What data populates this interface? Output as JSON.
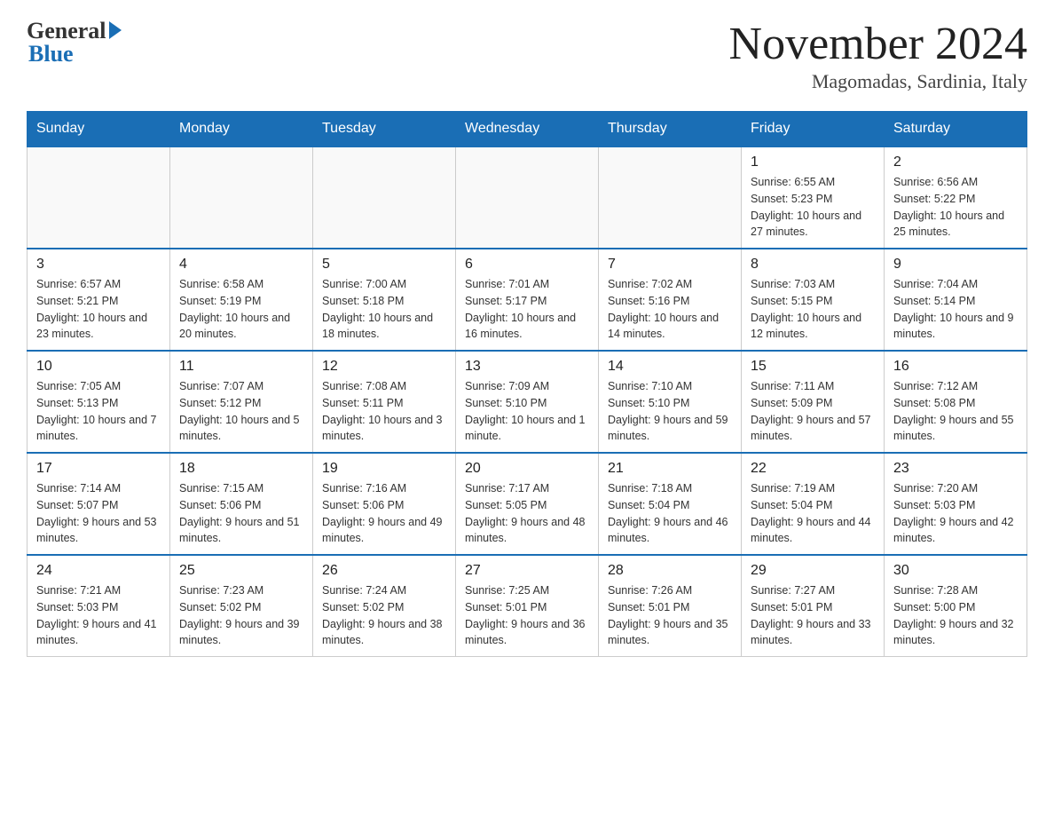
{
  "logo": {
    "general": "General",
    "blue": "Blue"
  },
  "title": "November 2024",
  "subtitle": "Magomadas, Sardinia, Italy",
  "weekdays": [
    "Sunday",
    "Monday",
    "Tuesday",
    "Wednesday",
    "Thursday",
    "Friday",
    "Saturday"
  ],
  "weeks": [
    [
      {
        "day": "",
        "info": ""
      },
      {
        "day": "",
        "info": ""
      },
      {
        "day": "",
        "info": ""
      },
      {
        "day": "",
        "info": ""
      },
      {
        "day": "",
        "info": ""
      },
      {
        "day": "1",
        "info": "Sunrise: 6:55 AM\nSunset: 5:23 PM\nDaylight: 10 hours and 27 minutes."
      },
      {
        "day": "2",
        "info": "Sunrise: 6:56 AM\nSunset: 5:22 PM\nDaylight: 10 hours and 25 minutes."
      }
    ],
    [
      {
        "day": "3",
        "info": "Sunrise: 6:57 AM\nSunset: 5:21 PM\nDaylight: 10 hours and 23 minutes."
      },
      {
        "day": "4",
        "info": "Sunrise: 6:58 AM\nSunset: 5:19 PM\nDaylight: 10 hours and 20 minutes."
      },
      {
        "day": "5",
        "info": "Sunrise: 7:00 AM\nSunset: 5:18 PM\nDaylight: 10 hours and 18 minutes."
      },
      {
        "day": "6",
        "info": "Sunrise: 7:01 AM\nSunset: 5:17 PM\nDaylight: 10 hours and 16 minutes."
      },
      {
        "day": "7",
        "info": "Sunrise: 7:02 AM\nSunset: 5:16 PM\nDaylight: 10 hours and 14 minutes."
      },
      {
        "day": "8",
        "info": "Sunrise: 7:03 AM\nSunset: 5:15 PM\nDaylight: 10 hours and 12 minutes."
      },
      {
        "day": "9",
        "info": "Sunrise: 7:04 AM\nSunset: 5:14 PM\nDaylight: 10 hours and 9 minutes."
      }
    ],
    [
      {
        "day": "10",
        "info": "Sunrise: 7:05 AM\nSunset: 5:13 PM\nDaylight: 10 hours and 7 minutes."
      },
      {
        "day": "11",
        "info": "Sunrise: 7:07 AM\nSunset: 5:12 PM\nDaylight: 10 hours and 5 minutes."
      },
      {
        "day": "12",
        "info": "Sunrise: 7:08 AM\nSunset: 5:11 PM\nDaylight: 10 hours and 3 minutes."
      },
      {
        "day": "13",
        "info": "Sunrise: 7:09 AM\nSunset: 5:10 PM\nDaylight: 10 hours and 1 minute."
      },
      {
        "day": "14",
        "info": "Sunrise: 7:10 AM\nSunset: 5:10 PM\nDaylight: 9 hours and 59 minutes."
      },
      {
        "day": "15",
        "info": "Sunrise: 7:11 AM\nSunset: 5:09 PM\nDaylight: 9 hours and 57 minutes."
      },
      {
        "day": "16",
        "info": "Sunrise: 7:12 AM\nSunset: 5:08 PM\nDaylight: 9 hours and 55 minutes."
      }
    ],
    [
      {
        "day": "17",
        "info": "Sunrise: 7:14 AM\nSunset: 5:07 PM\nDaylight: 9 hours and 53 minutes."
      },
      {
        "day": "18",
        "info": "Sunrise: 7:15 AM\nSunset: 5:06 PM\nDaylight: 9 hours and 51 minutes."
      },
      {
        "day": "19",
        "info": "Sunrise: 7:16 AM\nSunset: 5:06 PM\nDaylight: 9 hours and 49 minutes."
      },
      {
        "day": "20",
        "info": "Sunrise: 7:17 AM\nSunset: 5:05 PM\nDaylight: 9 hours and 48 minutes."
      },
      {
        "day": "21",
        "info": "Sunrise: 7:18 AM\nSunset: 5:04 PM\nDaylight: 9 hours and 46 minutes."
      },
      {
        "day": "22",
        "info": "Sunrise: 7:19 AM\nSunset: 5:04 PM\nDaylight: 9 hours and 44 minutes."
      },
      {
        "day": "23",
        "info": "Sunrise: 7:20 AM\nSunset: 5:03 PM\nDaylight: 9 hours and 42 minutes."
      }
    ],
    [
      {
        "day": "24",
        "info": "Sunrise: 7:21 AM\nSunset: 5:03 PM\nDaylight: 9 hours and 41 minutes."
      },
      {
        "day": "25",
        "info": "Sunrise: 7:23 AM\nSunset: 5:02 PM\nDaylight: 9 hours and 39 minutes."
      },
      {
        "day": "26",
        "info": "Sunrise: 7:24 AM\nSunset: 5:02 PM\nDaylight: 9 hours and 38 minutes."
      },
      {
        "day": "27",
        "info": "Sunrise: 7:25 AM\nSunset: 5:01 PM\nDaylight: 9 hours and 36 minutes."
      },
      {
        "day": "28",
        "info": "Sunrise: 7:26 AM\nSunset: 5:01 PM\nDaylight: 9 hours and 35 minutes."
      },
      {
        "day": "29",
        "info": "Sunrise: 7:27 AM\nSunset: 5:01 PM\nDaylight: 9 hours and 33 minutes."
      },
      {
        "day": "30",
        "info": "Sunrise: 7:28 AM\nSunset: 5:00 PM\nDaylight: 9 hours and 32 minutes."
      }
    ]
  ]
}
